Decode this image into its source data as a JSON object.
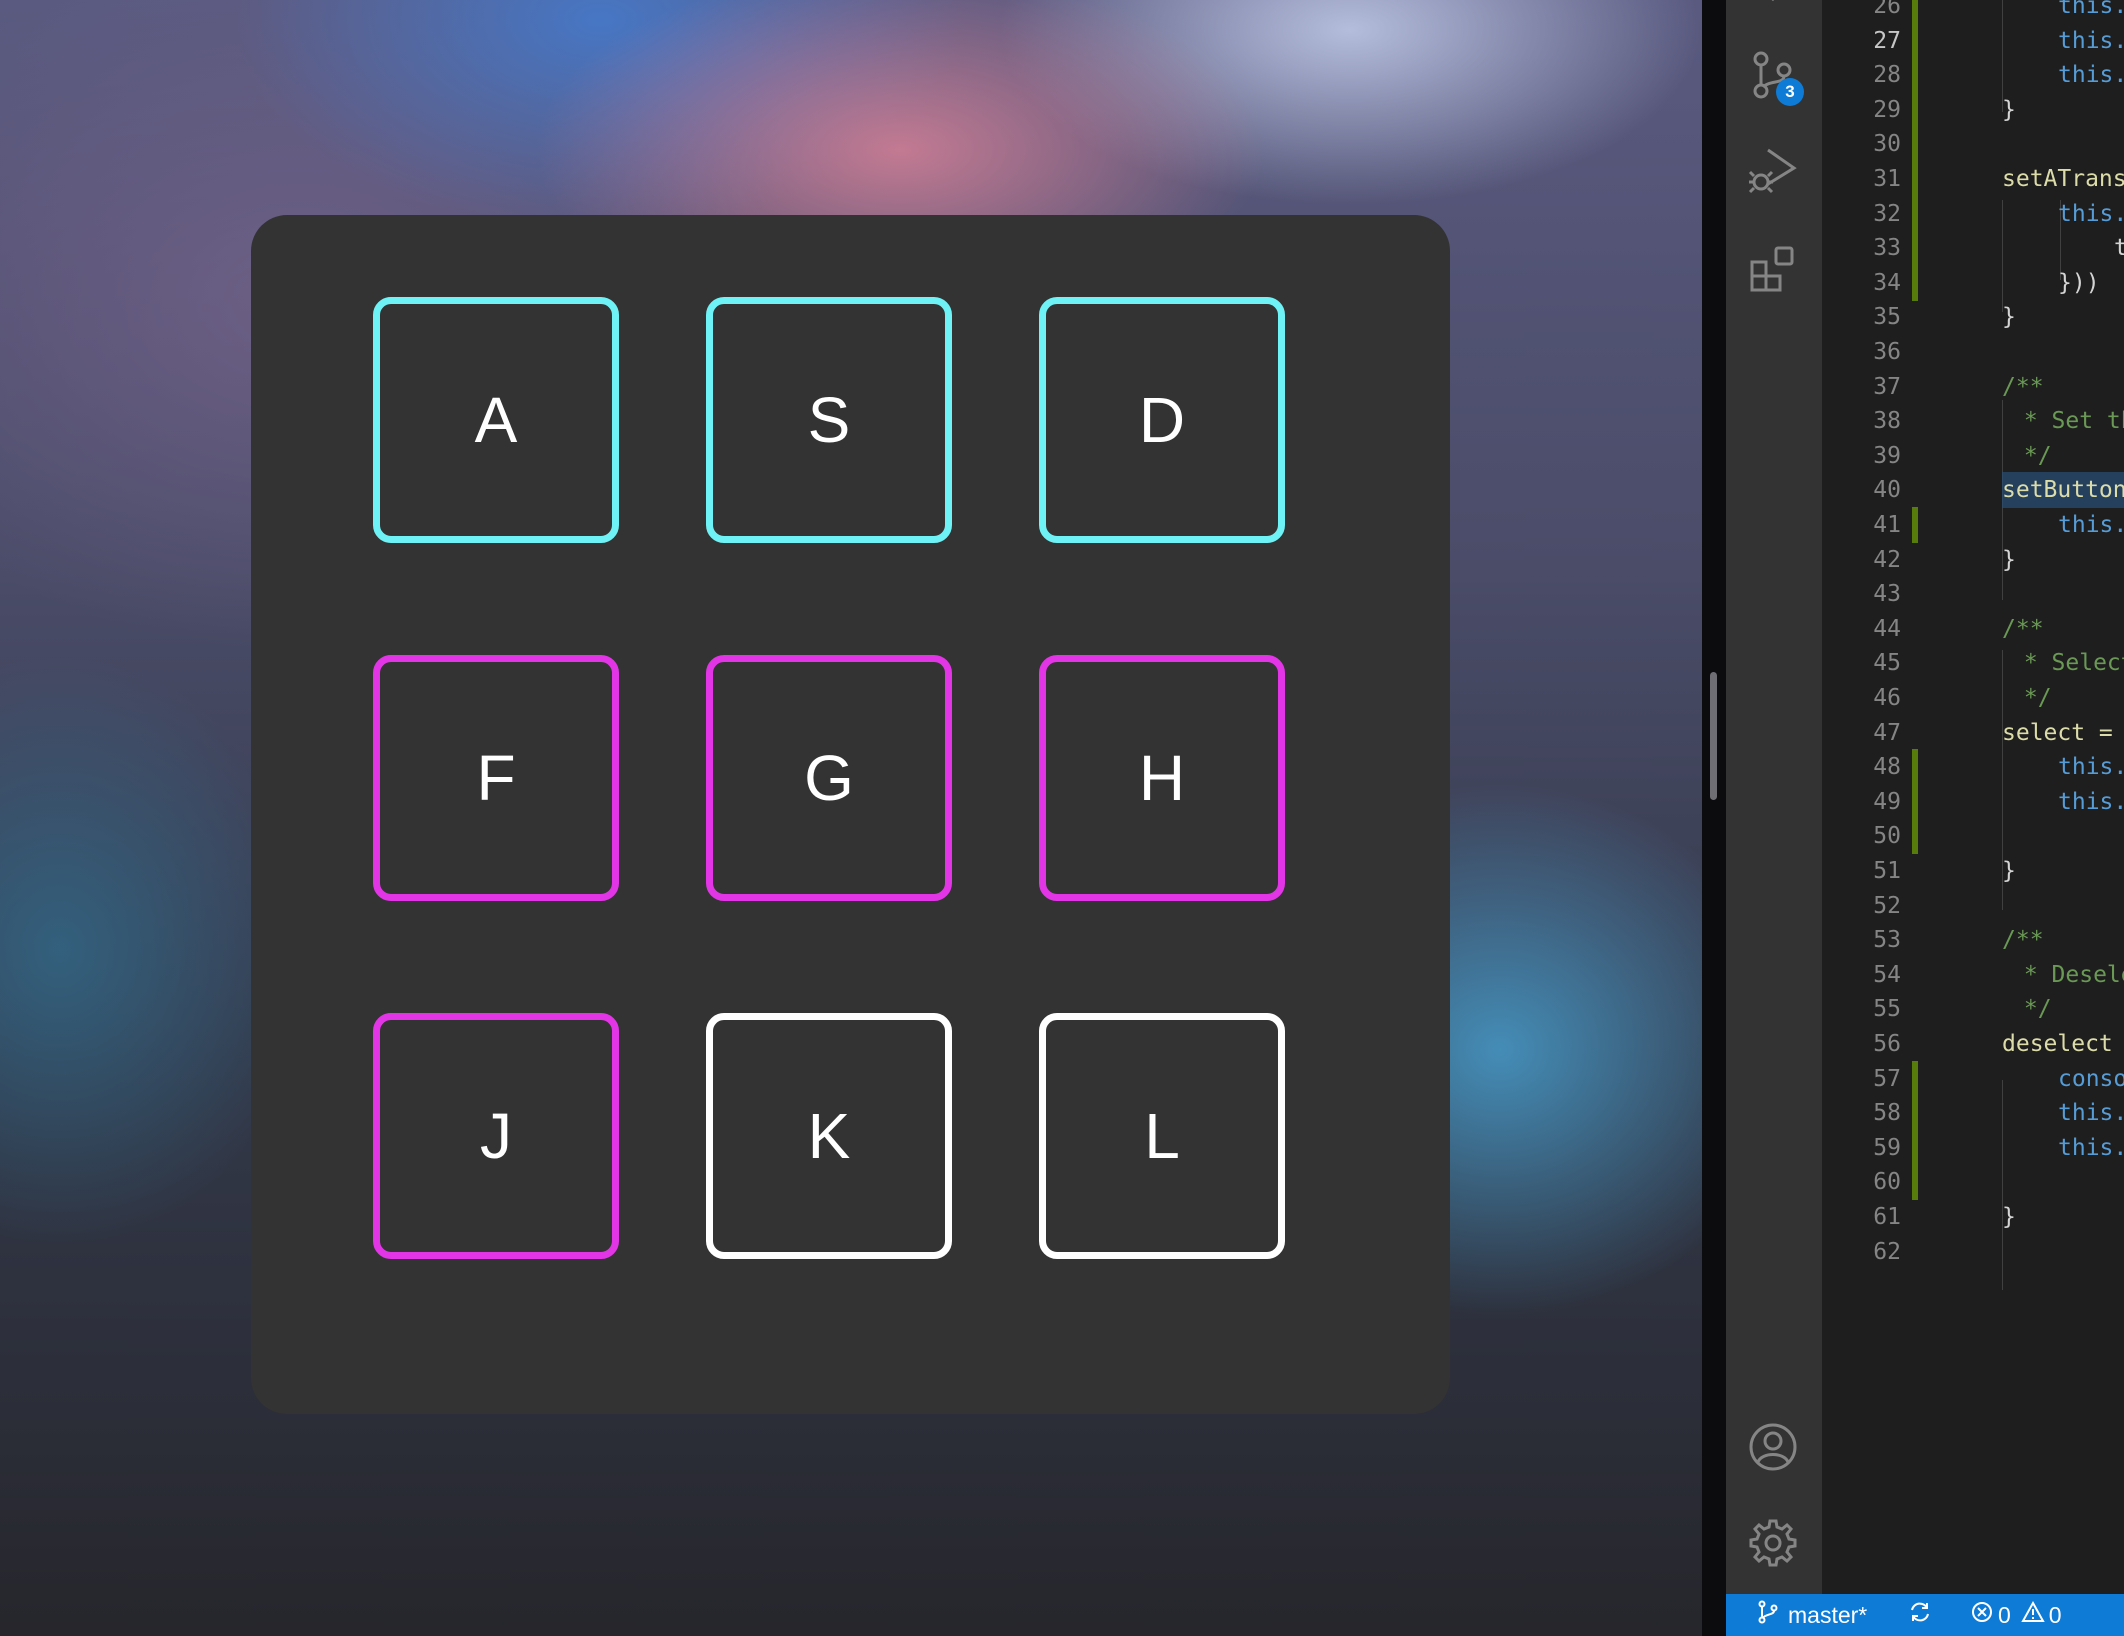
{
  "keypad": {
    "keys": [
      {
        "label": "A",
        "color": "#6ff2f5"
      },
      {
        "label": "S",
        "color": "#6ff2f5"
      },
      {
        "label": "D",
        "color": "#6ff2f5"
      },
      {
        "label": "F",
        "color": "#e236e6"
      },
      {
        "label": "G",
        "color": "#e236e6"
      },
      {
        "label": "H",
        "color": "#e236e6"
      },
      {
        "label": "J",
        "color": "#e236e6"
      },
      {
        "label": "K",
        "color": "#ffffff"
      },
      {
        "label": "L",
        "color": "#ffffff"
      }
    ]
  },
  "activity_bar": {
    "icons": [
      "source-control-icon",
      "run-debug-icon",
      "extensions-icon",
      "account-icon",
      "settings-gear-icon"
    ],
    "source_control_badge": "3"
  },
  "editor": {
    "lines": [
      {
        "num": "26",
        "text": "this.",
        "kind": "this"
      },
      {
        "num": "27",
        "text": "this.",
        "kind": "this"
      },
      {
        "num": "28",
        "text": "this.",
        "kind": "this"
      },
      {
        "num": "29",
        "text": "}",
        "kind": "plain"
      },
      {
        "num": "30",
        "text": "",
        "kind": "plain"
      },
      {
        "num": "31",
        "text": "setATrans",
        "kind": "method"
      },
      {
        "num": "32",
        "text": "this.",
        "kind": "this"
      },
      {
        "num": "33",
        "text": "t",
        "kind": "plain"
      },
      {
        "num": "34",
        "text": "}))",
        "kind": "plain"
      },
      {
        "num": "35",
        "text": "}",
        "kind": "plain"
      },
      {
        "num": "36",
        "text": "",
        "kind": "plain"
      },
      {
        "num": "37",
        "text": "/**",
        "kind": "comment"
      },
      {
        "num": "38",
        "text": " * Set th",
        "kind": "comment"
      },
      {
        "num": "39",
        "text": " */",
        "kind": "comment"
      },
      {
        "num": "40",
        "text": "setButton",
        "kind": "method"
      },
      {
        "num": "41",
        "text": "this.",
        "kind": "this"
      },
      {
        "num": "42",
        "text": "}",
        "kind": "plain"
      },
      {
        "num": "43",
        "text": "",
        "kind": "plain"
      },
      {
        "num": "44",
        "text": "/**",
        "kind": "comment"
      },
      {
        "num": "45",
        "text": " * Select",
        "kind": "comment"
      },
      {
        "num": "46",
        "text": " */",
        "kind": "comment"
      },
      {
        "num": "47",
        "text": "select =",
        "kind": "method"
      },
      {
        "num": "48",
        "text": "this.",
        "kind": "this"
      },
      {
        "num": "49",
        "text": "this.",
        "kind": "this"
      },
      {
        "num": "50",
        "text": "",
        "kind": "plain"
      },
      {
        "num": "51",
        "text": "}",
        "kind": "plain"
      },
      {
        "num": "52",
        "text": "",
        "kind": "plain"
      },
      {
        "num": "53",
        "text": "/**",
        "kind": "comment"
      },
      {
        "num": "54",
        "text": " * Desele",
        "kind": "comment"
      },
      {
        "num": "55",
        "text": " */",
        "kind": "comment"
      },
      {
        "num": "56",
        "text": "deselect",
        "kind": "method"
      },
      {
        "num": "57",
        "text": "conso",
        "kind": "this"
      },
      {
        "num": "58",
        "text": "this.",
        "kind": "this"
      },
      {
        "num": "59",
        "text": "this.",
        "kind": "this"
      },
      {
        "num": "60",
        "text": "",
        "kind": "plain"
      },
      {
        "num": "61",
        "text": "}",
        "kind": "plain"
      },
      {
        "num": "62",
        "text": "",
        "kind": "plain"
      }
    ],
    "active_line": "27"
  },
  "status_bar": {
    "branch": "master*",
    "errors": "0",
    "warnings": "0"
  },
  "colors": {
    "this_keyword": "#569cd6",
    "method": "#dcdcaa",
    "comment": "#6a9955",
    "plain": "#d4d4d4",
    "status_bar": "#0e7bd6"
  }
}
